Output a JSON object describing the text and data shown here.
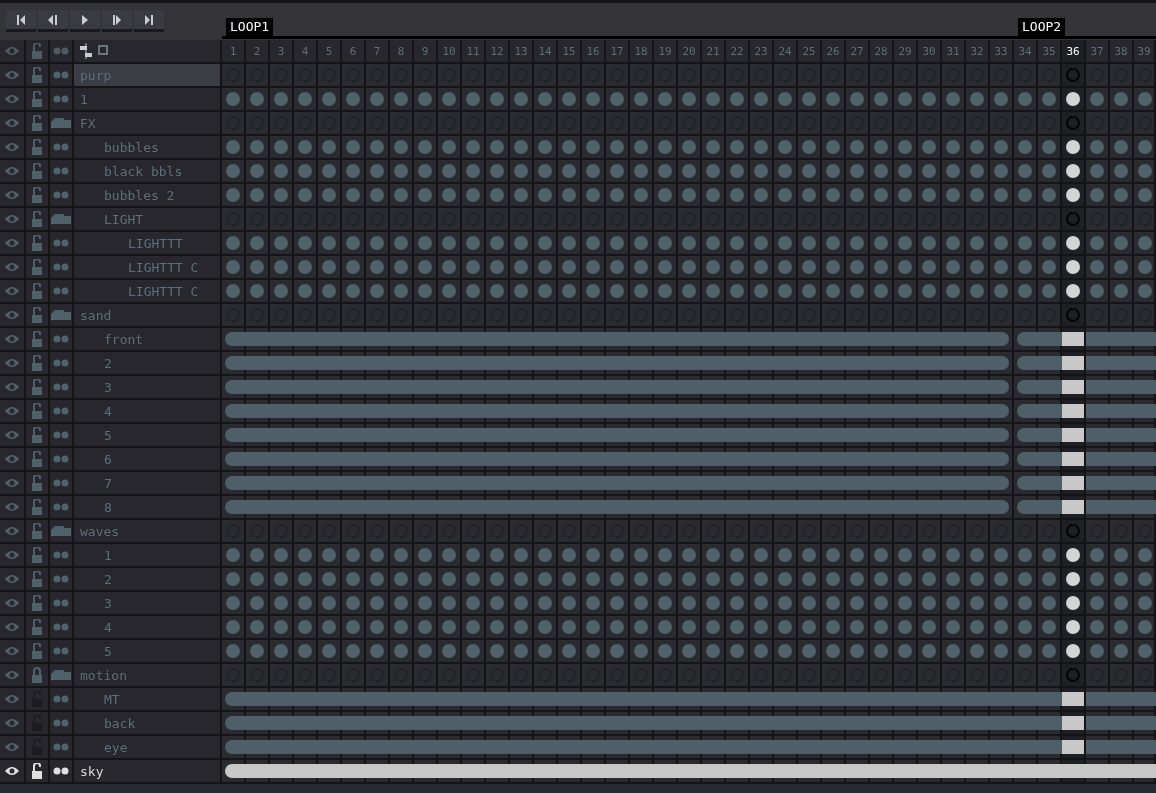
{
  "playback_buttons": [
    {
      "kind": "first"
    },
    {
      "kind": "prev"
    },
    {
      "kind": "play"
    },
    {
      "kind": "next"
    },
    {
      "kind": "last"
    }
  ],
  "tags": [
    {
      "label": "LOOP1"
    },
    {
      "label": "LOOP2"
    }
  ],
  "frames": [
    {
      "label": "1",
      "selected": false,
      "tag_start": true
    },
    {
      "label": "2",
      "selected": false,
      "tag_start": false
    },
    {
      "label": "3",
      "selected": false,
      "tag_start": false
    },
    {
      "label": "4",
      "selected": false,
      "tag_start": false
    },
    {
      "label": "5",
      "selected": false,
      "tag_start": false
    },
    {
      "label": "6",
      "selected": false,
      "tag_start": false
    },
    {
      "label": "7",
      "selected": false,
      "tag_start": false
    },
    {
      "label": "8",
      "selected": false,
      "tag_start": false
    },
    {
      "label": "9",
      "selected": false,
      "tag_start": false
    },
    {
      "label": "10",
      "selected": false,
      "tag_start": false
    },
    {
      "label": "11",
      "selected": false,
      "tag_start": false
    },
    {
      "label": "12",
      "selected": false,
      "tag_start": false
    },
    {
      "label": "13",
      "selected": false,
      "tag_start": false
    },
    {
      "label": "14",
      "selected": false,
      "tag_start": false
    },
    {
      "label": "15",
      "selected": false,
      "tag_start": false
    },
    {
      "label": "16",
      "selected": false,
      "tag_start": false
    },
    {
      "label": "17",
      "selected": false,
      "tag_start": false
    },
    {
      "label": "18",
      "selected": false,
      "tag_start": false
    },
    {
      "label": "19",
      "selected": false,
      "tag_start": false
    },
    {
      "label": "20",
      "selected": false,
      "tag_start": false
    },
    {
      "label": "21",
      "selected": false,
      "tag_start": false
    },
    {
      "label": "22",
      "selected": false,
      "tag_start": false
    },
    {
      "label": "23",
      "selected": false,
      "tag_start": false
    },
    {
      "label": "24",
      "selected": false,
      "tag_start": false
    },
    {
      "label": "25",
      "selected": false,
      "tag_start": false
    },
    {
      "label": "26",
      "selected": false,
      "tag_start": false
    },
    {
      "label": "27",
      "selected": false,
      "tag_start": false
    },
    {
      "label": "28",
      "selected": false,
      "tag_start": false
    },
    {
      "label": "29",
      "selected": false,
      "tag_start": false
    },
    {
      "label": "30",
      "selected": false,
      "tag_start": false
    },
    {
      "label": "31",
      "selected": false,
      "tag_start": false
    },
    {
      "label": "32",
      "selected": false,
      "tag_start": false
    },
    {
      "label": "33",
      "selected": false,
      "tag_start": false
    },
    {
      "label": "34",
      "selected": false,
      "tag_start": true
    },
    {
      "label": "35",
      "selected": false,
      "tag_start": false
    },
    {
      "label": "36",
      "selected": true,
      "tag_start": false
    },
    {
      "label": "37",
      "selected": false,
      "tag_start": false
    },
    {
      "label": "38",
      "selected": false,
      "tag_start": false
    },
    {
      "label": "39",
      "selected": false,
      "tag_start": false
    }
  ],
  "layers": [
    {
      "name": "purp",
      "kind": "layer",
      "visible": true,
      "locked": false,
      "hovered": true,
      "selected": false,
      "cels": {
        "kind": "empty"
      }
    },
    {
      "name": "1",
      "kind": "layer",
      "visible": true,
      "locked": false,
      "hovered": false,
      "selected": false,
      "cels": {
        "kind": "keyframe"
      }
    },
    {
      "name": "FX",
      "kind": "group",
      "visible": true,
      "locked": false,
      "hovered": false,
      "selected": false,
      "cels": {
        "kind": "empty"
      },
      "children": [
        {
          "name": "bubbles",
          "kind": "layer",
          "visible": true,
          "locked": false,
          "hovered": false,
          "selected": false,
          "cels": {
            "kind": "keyframe"
          }
        },
        {
          "name": "black bbls",
          "kind": "layer",
          "visible": true,
          "locked": false,
          "hovered": false,
          "selected": false,
          "cels": {
            "kind": "keyframe"
          }
        },
        {
          "name": "bubbles 2",
          "kind": "layer",
          "visible": true,
          "locked": false,
          "hovered": false,
          "selected": false,
          "cels": {
            "kind": "keyframe"
          }
        },
        {
          "name": "LIGHT",
          "kind": "group",
          "visible": true,
          "locked": false,
          "hovered": false,
          "selected": false,
          "cels": {
            "kind": "empty"
          },
          "children": [
            {
              "name": "LIGHTTT",
              "kind": "layer",
              "visible": true,
              "locked": false,
              "hovered": false,
              "selected": false,
              "cels": {
                "kind": "keyframe"
              }
            },
            {
              "name": "LIGHTTT C",
              "kind": "layer",
              "visible": true,
              "locked": false,
              "hovered": false,
              "selected": false,
              "cels": {
                "kind": "keyframe"
              }
            },
            {
              "name": "LIGHTTT C",
              "kind": "layer",
              "visible": true,
              "locked": false,
              "hovered": false,
              "selected": false,
              "cels": {
                "kind": "keyframe"
              }
            }
          ]
        }
      ]
    },
    {
      "name": "sand",
      "kind": "group",
      "visible": true,
      "locked": false,
      "hovered": false,
      "selected": false,
      "cels": {
        "kind": "empty"
      },
      "children": [
        {
          "name": "front",
          "kind": "layer",
          "visible": true,
          "locked": false,
          "hovered": false,
          "selected": false,
          "cels": {
            "kind": "linked_per_tag"
          }
        },
        {
          "name": "2",
          "kind": "layer",
          "visible": true,
          "locked": false,
          "hovered": false,
          "selected": false,
          "cels": {
            "kind": "linked_per_tag"
          }
        },
        {
          "name": "3",
          "kind": "layer",
          "visible": true,
          "locked": false,
          "hovered": false,
          "selected": false,
          "cels": {
            "kind": "linked_per_tag"
          }
        },
        {
          "name": "4",
          "kind": "layer",
          "visible": true,
          "locked": false,
          "hovered": false,
          "selected": false,
          "cels": {
            "kind": "linked_per_tag"
          }
        },
        {
          "name": "5",
          "kind": "layer",
          "visible": true,
          "locked": false,
          "hovered": false,
          "selected": false,
          "cels": {
            "kind": "linked_per_tag"
          }
        },
        {
          "name": "6",
          "kind": "layer",
          "visible": true,
          "locked": false,
          "hovered": false,
          "selected": false,
          "cels": {
            "kind": "linked_per_tag"
          }
        },
        {
          "name": "7",
          "kind": "layer",
          "visible": true,
          "locked": false,
          "hovered": false,
          "selected": false,
          "cels": {
            "kind": "linked_per_tag"
          }
        },
        {
          "name": "8",
          "kind": "layer",
          "visible": true,
          "locked": false,
          "hovered": false,
          "selected": false,
          "cels": {
            "kind": "linked_per_tag"
          }
        }
      ]
    },
    {
      "name": "waves",
      "kind": "group",
      "visible": true,
      "locked": false,
      "hovered": false,
      "selected": false,
      "cels": {
        "kind": "empty"
      },
      "children": [
        {
          "name": "1",
          "kind": "layer",
          "visible": true,
          "locked": false,
          "hovered": false,
          "selected": false,
          "cels": {
            "kind": "keyframe"
          }
        },
        {
          "name": "2",
          "kind": "layer",
          "visible": true,
          "locked": false,
          "hovered": false,
          "selected": false,
          "cels": {
            "kind": "keyframe"
          }
        },
        {
          "name": "3",
          "kind": "layer",
          "visible": true,
          "locked": false,
          "hovered": false,
          "selected": false,
          "cels": {
            "kind": "keyframe"
          }
        },
        {
          "name": "4",
          "kind": "layer",
          "visible": true,
          "locked": false,
          "hovered": false,
          "selected": false,
          "cels": {
            "kind": "keyframe"
          }
        },
        {
          "name": "5",
          "kind": "layer",
          "visible": true,
          "locked": false,
          "hovered": false,
          "selected": false,
          "cels": {
            "kind": "keyframe"
          }
        }
      ]
    },
    {
      "name": "motion",
      "kind": "group",
      "visible": true,
      "locked": true,
      "hovered": false,
      "selected": false,
      "cels": {
        "kind": "empty"
      },
      "children": [
        {
          "name": "MT",
          "kind": "layer",
          "visible": true,
          "locked": false,
          "hovered": false,
          "selected": false,
          "cels": {
            "kind": "linked"
          }
        },
        {
          "name": "back",
          "kind": "layer",
          "visible": true,
          "locked": false,
          "hovered": false,
          "selected": false,
          "cels": {
            "kind": "linked"
          }
        },
        {
          "name": "eye",
          "kind": "layer",
          "visible": true,
          "locked": false,
          "hovered": false,
          "selected": false,
          "cels": {
            "kind": "linked"
          }
        }
      ]
    },
    {
      "name": "sky",
      "kind": "layer",
      "visible": true,
      "locked": false,
      "hovered": false,
      "selected": true,
      "cels": {
        "kind": "linked"
      }
    }
  ]
}
